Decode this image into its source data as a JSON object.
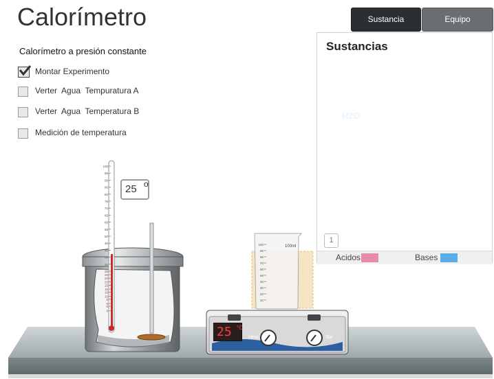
{
  "app": {
    "title": "Calorímetro"
  },
  "tabs": [
    {
      "label": "Sustancia",
      "active": true
    },
    {
      "label": "Equipo",
      "active": false
    }
  ],
  "procedure": {
    "title": "Calorímetro a presión constante",
    "steps": [
      {
        "label": "Montar Experimento",
        "checked": true
      },
      {
        "label": "Verter  Agua  Tempuratura A",
        "checked": false
      },
      {
        "label": "Verter  Agua  Temperatura B",
        "checked": false
      },
      {
        "label": "Medición de temperatura",
        "checked": false
      }
    ]
  },
  "thermometer": {
    "reading": "25",
    "degree_symbol": "o",
    "scale_labels": [
      "100",
      "95",
      "90",
      "85",
      "80",
      "75",
      "70",
      "65",
      "60",
      "55",
      "50",
      "45",
      "40",
      "35",
      "30",
      "25",
      "20",
      "15",
      "10",
      "5",
      "0"
    ],
    "inner_labels": [
      "25",
      "20",
      "15",
      "10",
      "5",
      "0"
    ]
  },
  "beaker": {
    "volume_label": "100ml",
    "scale_labels": [
      "100",
      "90",
      "80",
      "70",
      "60",
      "50",
      "40",
      "30",
      "20",
      "10"
    ]
  },
  "hotplate": {
    "display_value": "25",
    "display_unit": "°C",
    "heat_label": "Heat",
    "stir_label": "Stir",
    "display_color": "#ff3b3b"
  },
  "substances_panel": {
    "title": "Sustancias",
    "items": [
      {
        "label": "H2O"
      }
    ],
    "page": "1",
    "legend": [
      {
        "label": "Acidos",
        "color": "#e88aac"
      },
      {
        "label": "Bases",
        "color": "#5aaee6"
      }
    ]
  }
}
